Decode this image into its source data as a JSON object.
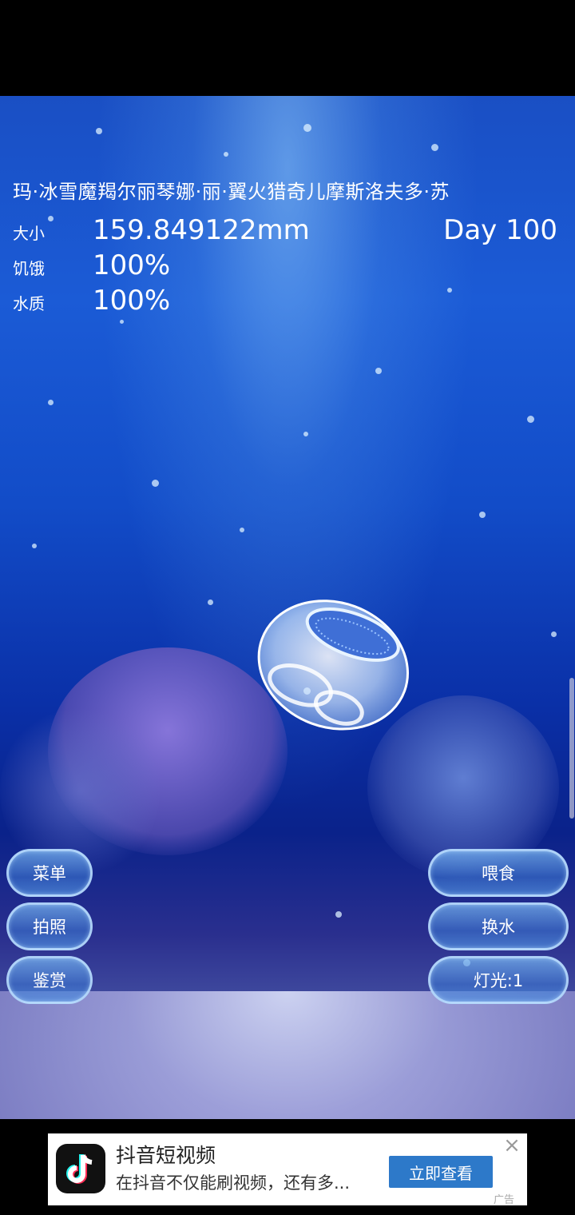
{
  "creature": {
    "name": "玛·冰雪魔羯尔丽琴娜·丽·翼火猎奇儿摩斯洛夫多·苏",
    "day": "Day 100"
  },
  "stats": [
    {
      "label": "大小",
      "value": "159.849122mm"
    },
    {
      "label": "饥饿",
      "value": "100%"
    },
    {
      "label": "水质",
      "value": "100%"
    }
  ],
  "buttons_left": {
    "menu": "菜单",
    "photo": "拍照",
    "appraise": "鉴赏"
  },
  "buttons_right": {
    "feed": "喂食",
    "change_water": "换水",
    "light": "灯光:1"
  },
  "ad": {
    "app_name": "抖音短视频",
    "description": "在抖音不仅能刷视频，还有多...",
    "cta": "立即查看",
    "close_icon": "close-icon",
    "tag": "广告"
  },
  "colors": {
    "water_top": "#1b5bd6",
    "water_deep": "#0a228a",
    "ad_cta": "#2d79c9"
  }
}
